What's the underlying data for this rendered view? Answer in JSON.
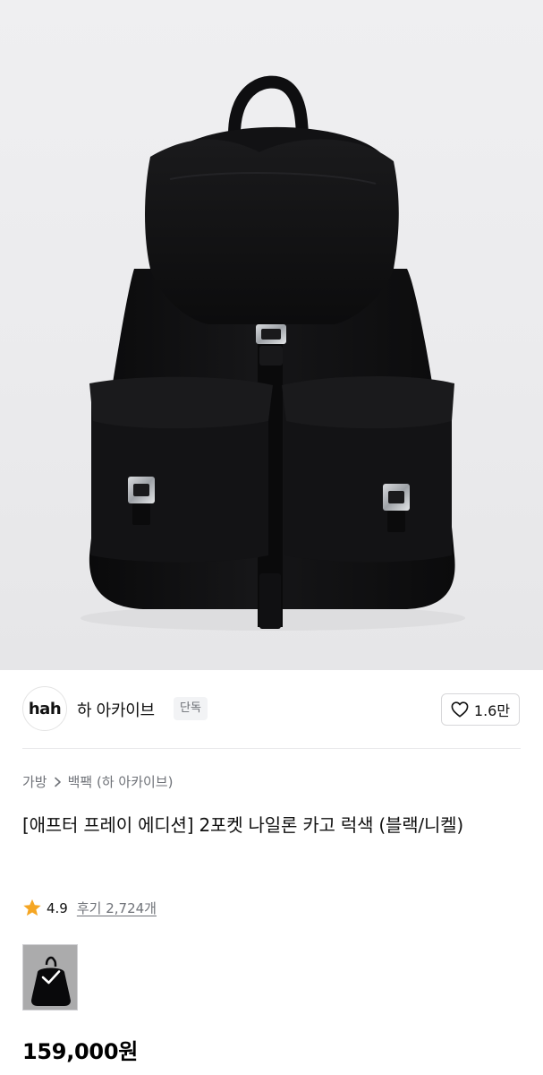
{
  "brand": {
    "logo_text": "hah",
    "name": "하 아카이브",
    "badge": "단독"
  },
  "like": {
    "icon": "heart-icon",
    "count": "1.6만"
  },
  "breadcrumb": {
    "category": "가방",
    "separator_icon": "chevron-right-icon",
    "subcategory": "백팩 (하 아카이브)"
  },
  "product": {
    "title": "[애프터 프레이 에디션] 2포켓 나일론 카고 럭색 (블랙/니켈)",
    "price": "159,000원"
  },
  "rating": {
    "icon": "star-icon",
    "value": "4.9",
    "review_label": "후기 2,724개"
  },
  "option": {
    "selected_icon": "check-icon"
  },
  "colors": {
    "star": "#f5a623",
    "bag": "#0d0d0f",
    "buckle": "#b9bcc0",
    "muted_text": "#6f7278"
  }
}
